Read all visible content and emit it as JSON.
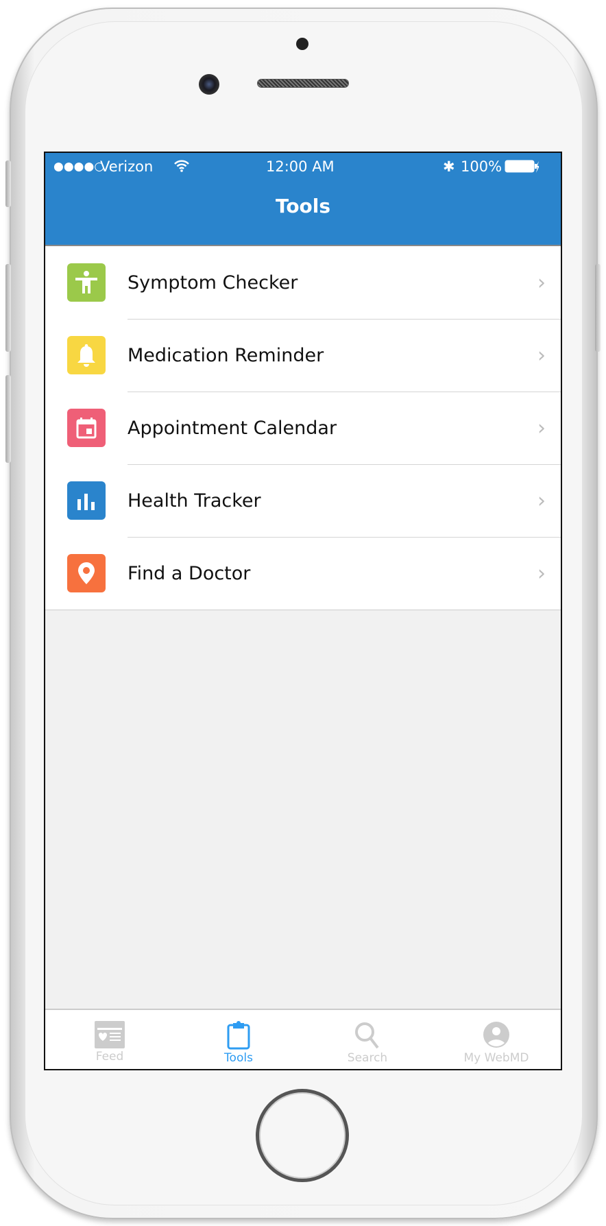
{
  "status_bar": {
    "carrier": "Verizon",
    "signal": "●●●●○",
    "time": "12:00 AM",
    "battery": "100%"
  },
  "nav": {
    "title": "Tools"
  },
  "tools": [
    {
      "label": "Symptom Checker",
      "icon": "person-icon",
      "color": "#9bc94a"
    },
    {
      "label": "Medication Reminder",
      "icon": "bell-icon",
      "color": "#f8d742"
    },
    {
      "label": "Appointment Calendar",
      "icon": "calendar-icon",
      "color": "#ef5f77"
    },
    {
      "label": "Health Tracker",
      "icon": "bar-chart-icon",
      "color": "#2a84cc"
    },
    {
      "label": "Find a Doctor",
      "icon": "map-pin-icon",
      "color": "#f7713e"
    }
  ],
  "tabbar": {
    "items": [
      {
        "label": "Feed",
        "icon": "newspaper-icon"
      },
      {
        "label": "Tools",
        "icon": "clipboard-icon",
        "active": true
      },
      {
        "label": "Search",
        "icon": "search-icon"
      },
      {
        "label": "My WebMD",
        "icon": "user-icon"
      }
    ],
    "active_color": "#2e9cf2",
    "inactive_color": "#cccccc"
  }
}
